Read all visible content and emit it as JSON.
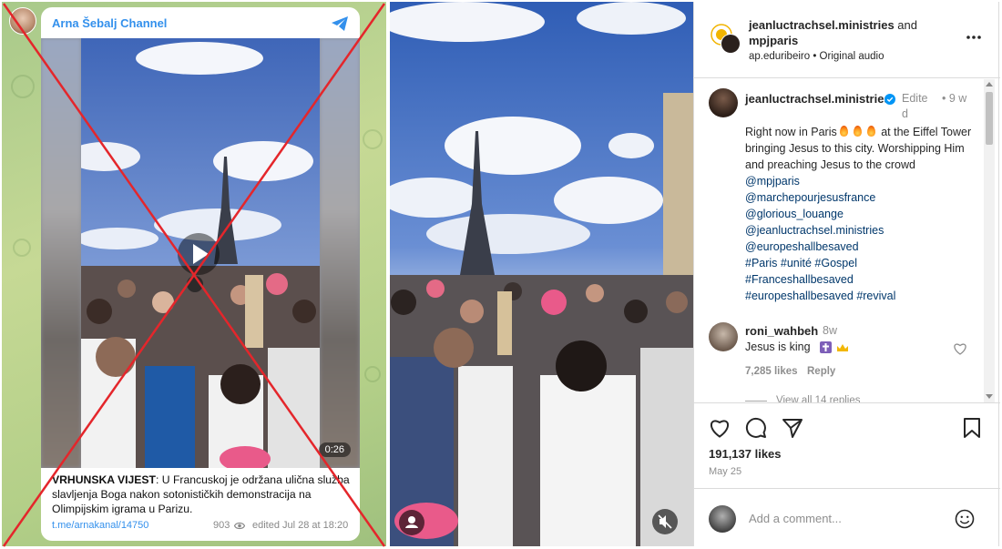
{
  "telegram": {
    "channel_name": "Arna Šebalj Channel",
    "duration": "0:26",
    "headline": "VRHUNSKA VIJEST",
    "message": ": U Francuskoj je održana ulična služba slavljenja Boga nakon sotonističkih demonstracija na Olimpijskim igrama u Parizu.",
    "link": "t.me/arnakanal/14750",
    "views": "903",
    "edited": "edited  Jul 28 at 18:20",
    "accent_color": "#3390ec"
  },
  "instagram": {
    "header": {
      "user1": "jeanluctrachsel.ministries",
      "joiner": " and ",
      "user2": "mpjparis",
      "subtitle": "ap.eduribeiro • Original audio"
    },
    "caption": {
      "username": "jeanluctrachsel.ministries",
      "edited": "Edited",
      "time": "• 9 w",
      "text_line1": "Right now in Paris",
      "text_line2": "at the Eiffel Tower bringing Jesus to this city. Worshipping Him and preaching Jesus to the crowd",
      "mention1": "@mpjparis",
      "mention2": "@marchepourjesusfrance",
      "mention3": "@glorious_louange",
      "mention4": "@jeanluctrachsel.ministries",
      "mention5": "@europeshallbesaved",
      "hashtags1": "#Paris #unité #Gospel",
      "hashtags2": "#Franceshallbesaved",
      "hashtags3": "#europeshallbesaved #revival"
    },
    "comment": {
      "username": "roni_wahbeh",
      "time": "8w",
      "text": "Jesus is king",
      "likes": "7,285 likes",
      "reply": "Reply",
      "view_all": "View all 14 replies"
    },
    "likes": "191,137 likes",
    "date": "May 25",
    "comment_placeholder": "Add a comment...",
    "link_color": "#00376b"
  },
  "overlay": {
    "cross_color": "#e4262b"
  }
}
